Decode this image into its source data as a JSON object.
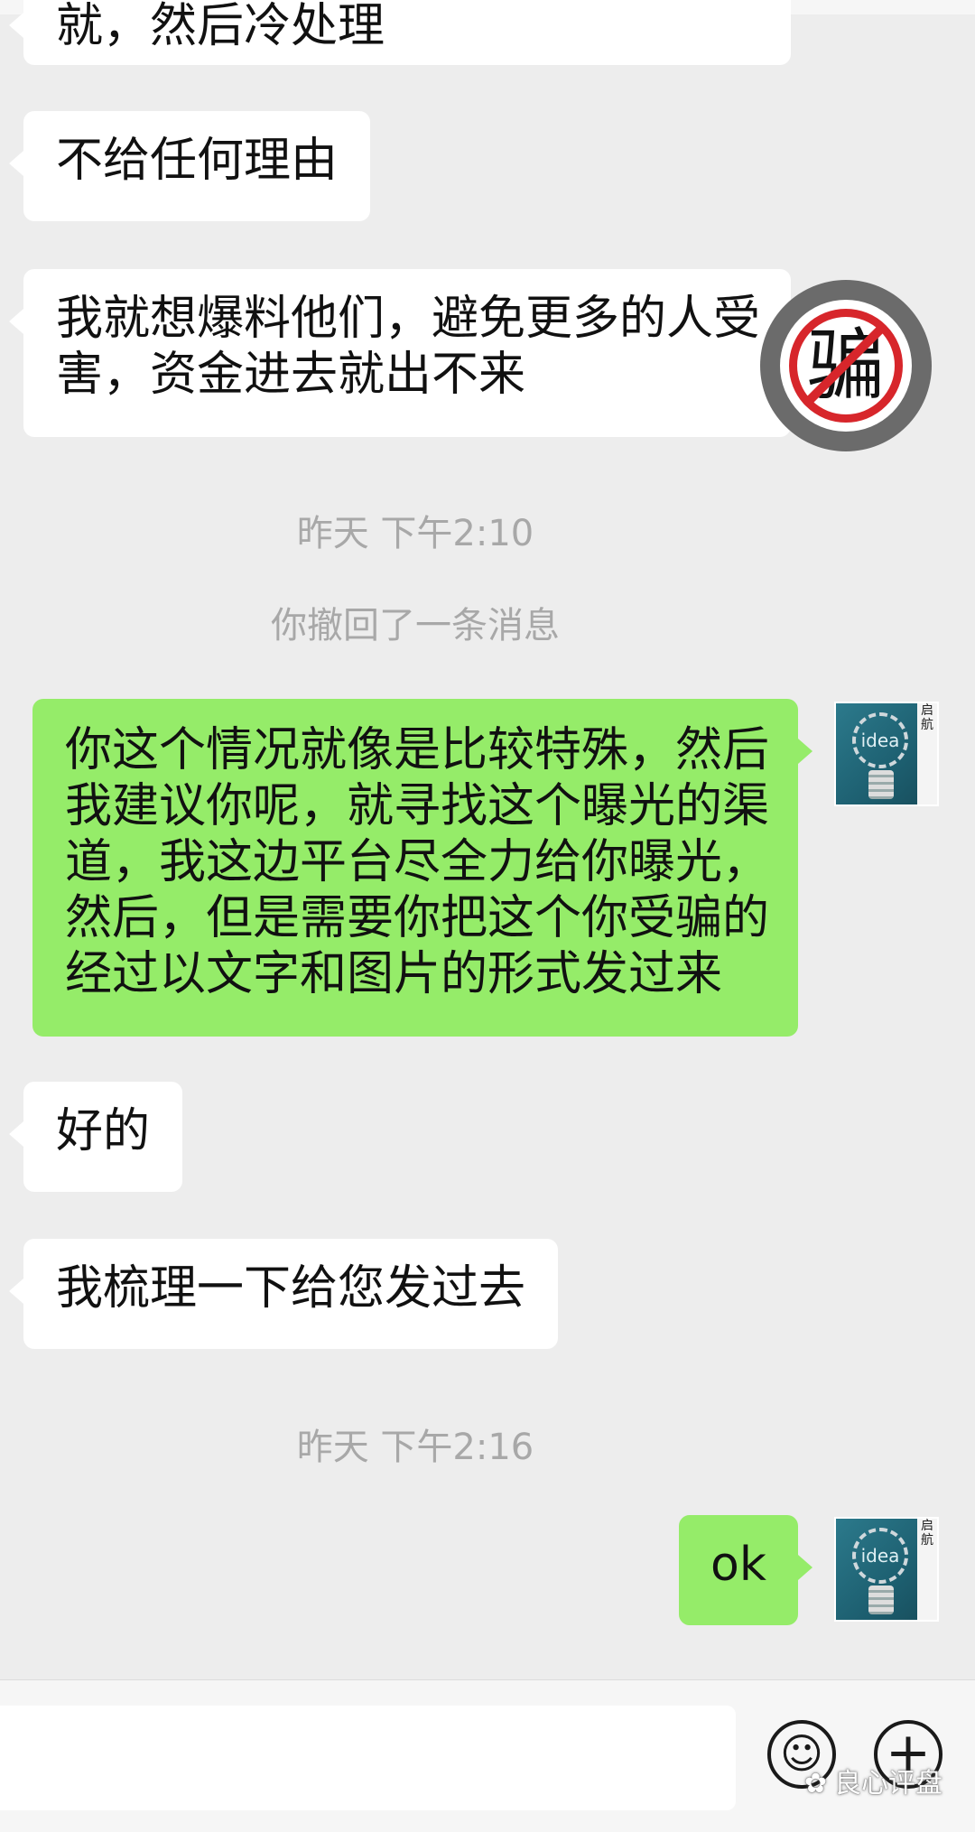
{
  "messages": {
    "m1": {
      "lines": [
        "就，然后冷处理"
      ]
    },
    "m2": {
      "lines": [
        "不给任何理由"
      ]
    },
    "m3": {
      "lines": [
        "我就想爆料他们，避免更多的人受",
        "害，资金进去就出不来"
      ]
    },
    "time1": "昨天 下午2:10",
    "recall_notice": "你撤回了一条消息",
    "m4": {
      "lines": [
        "你这个情况就像是比较特殊，然后",
        "我建议你呢，就寻找这个曝光的渠",
        "道，我这边平台尽全力给你曝光，",
        "然后，但是需要你把这个你受骗的",
        "经过以文字和图片的形式发过来"
      ]
    },
    "m5": {
      "lines": [
        "好的"
      ]
    },
    "m6": {
      "lines": [
        "我梳理一下给您发过去"
      ]
    },
    "time2": "昨天 下午2:16",
    "m7": {
      "lines": [
        "ok"
      ]
    }
  },
  "avatar": {
    "side_text": [
      "启",
      "航"
    ],
    "bulb_text": "idea"
  },
  "scam_badge": {
    "char": "骗"
  },
  "toolbar": {
    "emoji_icon": "emoji-icon",
    "plus_icon": "plus-icon"
  },
  "watermark": {
    "text": "良心评盘"
  },
  "colors": {
    "background": "#ededed",
    "bubble_left": "#ffffff",
    "bubble_right": "#95ec69",
    "badge_red": "#d7262b"
  }
}
